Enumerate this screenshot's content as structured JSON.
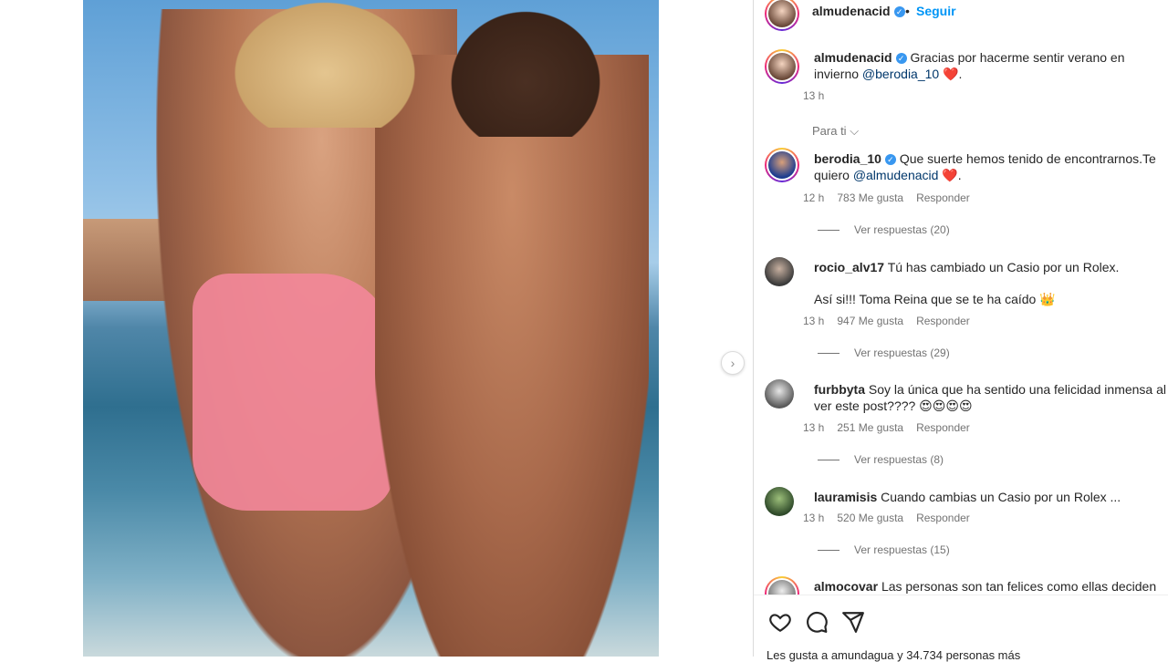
{
  "post": {
    "author": "almudenacid",
    "follow_label": "Seguir",
    "separator": "•"
  },
  "caption": {
    "user": "almudenacid",
    "text": "Gracias por hacerme sentir verano en invierno",
    "mention": "@berodia_10",
    "suffix": ".",
    "time": "13 h"
  },
  "filter_label": "Para ti",
  "comments": [
    {
      "user": "berodia_10",
      "verified": true,
      "text": "Que suerte hemos tenido de encontrarnos.Te quiero",
      "mention": "@almudenacid",
      "suffix": ".",
      "time": "12 h",
      "likes": "783 Me gusta",
      "reply": "Responder",
      "replies": "Ver respuestas (20)"
    },
    {
      "user": "rocio_alv17",
      "text": "Tú has cambiado un Casio por un Rolex.",
      "text2": "Así si!!! Toma Reina que se te ha caído 👑",
      "time": "13 h",
      "likes": "947 Me gusta",
      "reply": "Responder",
      "replies": "Ver respuestas (29)"
    },
    {
      "user": "furbbyta",
      "text": "Soy la única que ha sentido una felicidad inmensa al ver este post???? 😍😍😍😍",
      "time": "13 h",
      "likes": "251 Me gusta",
      "reply": "Responder",
      "replies": "Ver respuestas (8)"
    },
    {
      "user": "lauramisis",
      "text": "Cuando cambias un Casio por un Rolex ...",
      "time": "13 h",
      "likes": "520 Me gusta",
      "reply": "Responder",
      "replies": "Ver respuestas (15)"
    },
    {
      "user": "almocovar",
      "text": "Las personas son tan felices como ellas deciden ser."
    }
  ],
  "likes_summary": "Les gusta a amundagua y 34.734 personas más",
  "icons": {
    "like": "heart-icon",
    "comment": "comment-icon",
    "share": "share-icon",
    "next": "chevron-right-icon",
    "chevron": "chevron-down-icon"
  },
  "colors": {
    "link": "#0095f6",
    "mention": "#00376b",
    "heart": "#ed4956",
    "verified": "#3897f0"
  }
}
